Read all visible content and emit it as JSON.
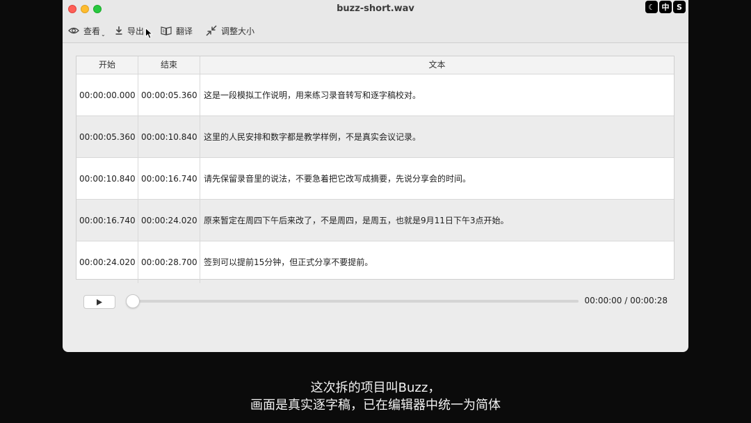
{
  "window": {
    "title": "buzz-short.wav"
  },
  "toolbar": {
    "view_label": "查看",
    "export_label": "导出",
    "translate_label": "翻译",
    "resize_label": "调整大小"
  },
  "table": {
    "headers": [
      "开始",
      "结束",
      "文本"
    ],
    "rows": [
      {
        "start": "00:00:00.000",
        "end": "00:00:05.360",
        "text": "这是一段模拟工作说明，用来练习录音转写和逐字稿校对。"
      },
      {
        "start": "00:00:05.360",
        "end": "00:00:10.840",
        "text": "这里的人民安排和数字都是教学样例，不是真实会议记录。"
      },
      {
        "start": "00:00:10.840",
        "end": "00:00:16.740",
        "text": "请先保留录音里的说法，不要急着把它改写成摘要，先说分享会的时间。"
      },
      {
        "start": "00:00:16.740",
        "end": "00:00:24.020",
        "text": "原来暂定在周四下午后来改了，不是周四，是周五，也就是9月11日下午3点开始。"
      },
      {
        "start": "00:00:24.020",
        "end": "00:00:28.700",
        "text": "签到可以提前15分钟，但正式分享不要提前。"
      }
    ]
  },
  "player": {
    "time_readout": "00:00:00 / 00:00:28",
    "progress": 0
  },
  "badges": [
    "☾",
    "中",
    "S"
  ],
  "subtitles": {
    "line1": "这次拆的项目叫Buzz，",
    "line2": "画面是真实逐字稿，已在编辑器中统一为简体"
  }
}
